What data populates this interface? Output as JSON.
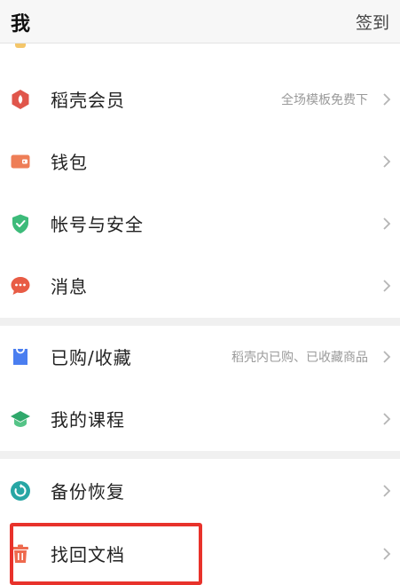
{
  "header": {
    "title": "我",
    "signin_label": "签到"
  },
  "menu": {
    "group1": [
      {
        "label": "稻壳会员",
        "subtitle": "全场模板免费下",
        "icon": "shield-hex-icon"
      },
      {
        "label": "钱包",
        "subtitle": "",
        "icon": "wallet-icon"
      },
      {
        "label": "帐号与安全",
        "subtitle": "",
        "icon": "security-shield-icon"
      },
      {
        "label": "消息",
        "subtitle": "",
        "icon": "chat-bubble-icon"
      }
    ],
    "group2": [
      {
        "label": "已购/收藏",
        "subtitle": "稻壳内已购、已收藏商品",
        "icon": "shopping-bag-icon"
      },
      {
        "label": "我的课程",
        "subtitle": "",
        "icon": "graduation-cap-icon"
      }
    ],
    "group3": [
      {
        "label": "备份恢复",
        "subtitle": "",
        "icon": "backup-restore-icon"
      },
      {
        "label": "找回文档",
        "subtitle": "",
        "icon": "trash-icon"
      }
    ]
  },
  "colors": {
    "member": "#e0564b",
    "wallet": "#ee7e57",
    "security": "#3dbb7a",
    "message": "#e85c45",
    "purchased": "#4a7ef0",
    "course": "#2fa86b",
    "backup": "#27a6a4",
    "recover": "#ee6a4e",
    "highlight": "#e8322b"
  }
}
